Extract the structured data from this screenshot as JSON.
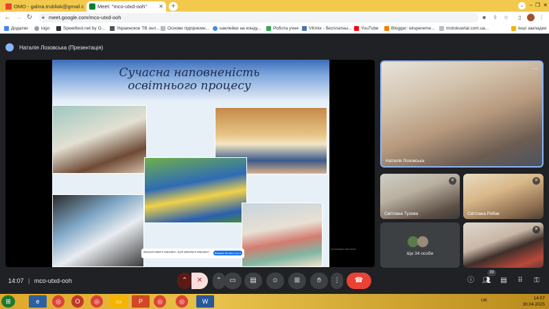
{
  "browser": {
    "tabs": [
      {
        "label": "ОМО - galina.trubliak@gmail.co",
        "active": false
      },
      {
        "label": "Meet: \"mco-utxd-ooh\"",
        "active": true
      }
    ],
    "url": "meet.google.com/mco-utxd-ooh",
    "bookmarks": [
      {
        "label": "Додатки",
        "icon": "apps-grid-icon"
      },
      {
        "label": "logo",
        "icon": "globe-icon"
      },
      {
        "label": "Speedtest.net by O...",
        "icon": "speedtest-icon"
      },
      {
        "label": "Украинское ТВ онл...",
        "icon": "tv-icon"
      },
      {
        "label": "Основи підприємн...",
        "icon": "page-icon"
      },
      {
        "label": "наклейки на конду...",
        "icon": "google-icon"
      },
      {
        "label": "Робота учня",
        "icon": "green-page-icon"
      },
      {
        "label": "VKmix - бесплатны...",
        "icon": "vk-icon"
      },
      {
        "label": "YouTube",
        "icon": "youtube-icon"
      },
      {
        "label": "Blogger: eksperеme...",
        "icon": "blogger-icon"
      },
      {
        "label": "motokvartal.com.ua...",
        "icon": "page-icon"
      }
    ],
    "other_bookmarks": "Інші закладки",
    "colors": {
      "tabstrip": "#f2c94c",
      "accent_red": "#ea4335",
      "meet_bg": "#202124"
    }
  },
  "meet": {
    "presenter_label": "Наталія Лозовська (Презентація)",
    "slide": {
      "title_line1": "Сучасна наповненість",
      "title_line2": "освітнього процесу",
      "caption_button": "Більше не сповщати",
      "caption_text": "використовуєте мікрофон. Щоб увімкнути мікрофон",
      "caption_extra": "Закрити",
      "watermark": "Активация Windows"
    },
    "participants": [
      {
        "name": "Наталія Лозовська",
        "muted": false
      },
      {
        "name": "Світлана Тузова",
        "muted": true
      },
      {
        "name": "Світлана Рибак",
        "muted": true
      },
      {
        "name": "Ще 34 особи",
        "muted": false
      },
      {
        "name": "",
        "muted": true
      }
    ],
    "time": "14:07",
    "meeting_code": "mco-utxd-ooh",
    "participant_count": "39"
  },
  "taskbar": {
    "language": "UK",
    "time": "14:07",
    "date": "30.04.2025"
  }
}
